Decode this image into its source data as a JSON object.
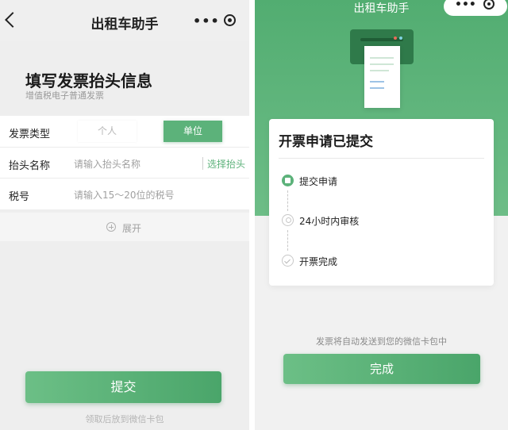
{
  "left": {
    "nav": {
      "title": "出租车助手",
      "back_icon": "chevron-left-icon",
      "more_icon": "more-dots-icon",
      "close_icon": "record-circle-icon"
    },
    "header": {
      "title": "填写发票抬头信息",
      "subtitle": "增值税电子普通发票"
    },
    "form": {
      "invoice_type": {
        "label": "发票类型",
        "options": [
          "个人",
          "单位"
        ],
        "selected": "单位"
      },
      "header_name": {
        "label": "抬头名称",
        "placeholder": "请输入抬头名称",
        "action": "选择抬头"
      },
      "tax_number": {
        "label": "税号",
        "placeholder": "请输入15～20位的税号"
      }
    },
    "expand": {
      "label": "展开",
      "icon": "plus-circle-icon"
    },
    "submit": {
      "label": "提交"
    },
    "hint": "领取后放到微信卡包"
  },
  "right": {
    "nav": {
      "title": "出租车助手",
      "more_icon": "more-dots-icon",
      "close_icon": "record-circle-icon"
    },
    "illustration": "printer-icon",
    "card": {
      "title": "开票申请已提交",
      "steps": [
        {
          "label": "提交申请",
          "icon": "document-icon",
          "state": "active"
        },
        {
          "label": "24小时内审核",
          "icon": "person-icon",
          "state": "pending"
        },
        {
          "label": "开票完成",
          "icon": "check-icon",
          "state": "pending"
        }
      ]
    },
    "hint": "发票将自动发送到您的微信卡包中",
    "done": {
      "label": "完成"
    }
  },
  "colors": {
    "accent": "#5cb27a",
    "accent_dark": "#2f7a4a",
    "background": "#eeeeee"
  }
}
